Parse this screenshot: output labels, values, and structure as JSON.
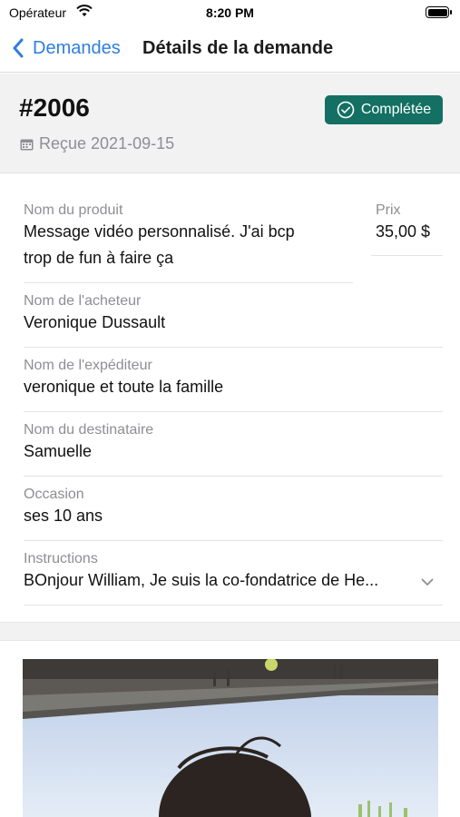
{
  "status_bar": {
    "carrier": "Opérateur",
    "time": "8:20 PM"
  },
  "nav": {
    "back_label": "Demandes",
    "title": "Détails de la demande"
  },
  "order": {
    "number": "#2006",
    "received": "Reçue 2021-09-15",
    "status": "Complétée",
    "status_color": "#137062"
  },
  "fields": {
    "product": {
      "label": "Nom du produit",
      "value_line1": "Message vidéo personnalisé. J'ai bcp",
      "value_line2": "trop de fun à faire ça"
    },
    "price": {
      "label": "Prix",
      "value": "35,00 $"
    },
    "buyer": {
      "label": "Nom de l'acheteur",
      "value": "Veronique Dussault"
    },
    "sender": {
      "label": "Nom de l'expéditeur",
      "value": "veronique et toute la famille"
    },
    "recipient": {
      "label": "Nom du destinataire",
      "value": "Samuelle"
    },
    "occasion": {
      "label": "Occasion",
      "value": "ses 10 ans"
    },
    "instructions": {
      "label": "Instructions",
      "value": "BOnjour William, Je suis la co-fondatrice de He..."
    }
  },
  "colors": {
    "accent": "#2f7de1",
    "badge": "#137062",
    "label_gray": "#8e8e93"
  }
}
